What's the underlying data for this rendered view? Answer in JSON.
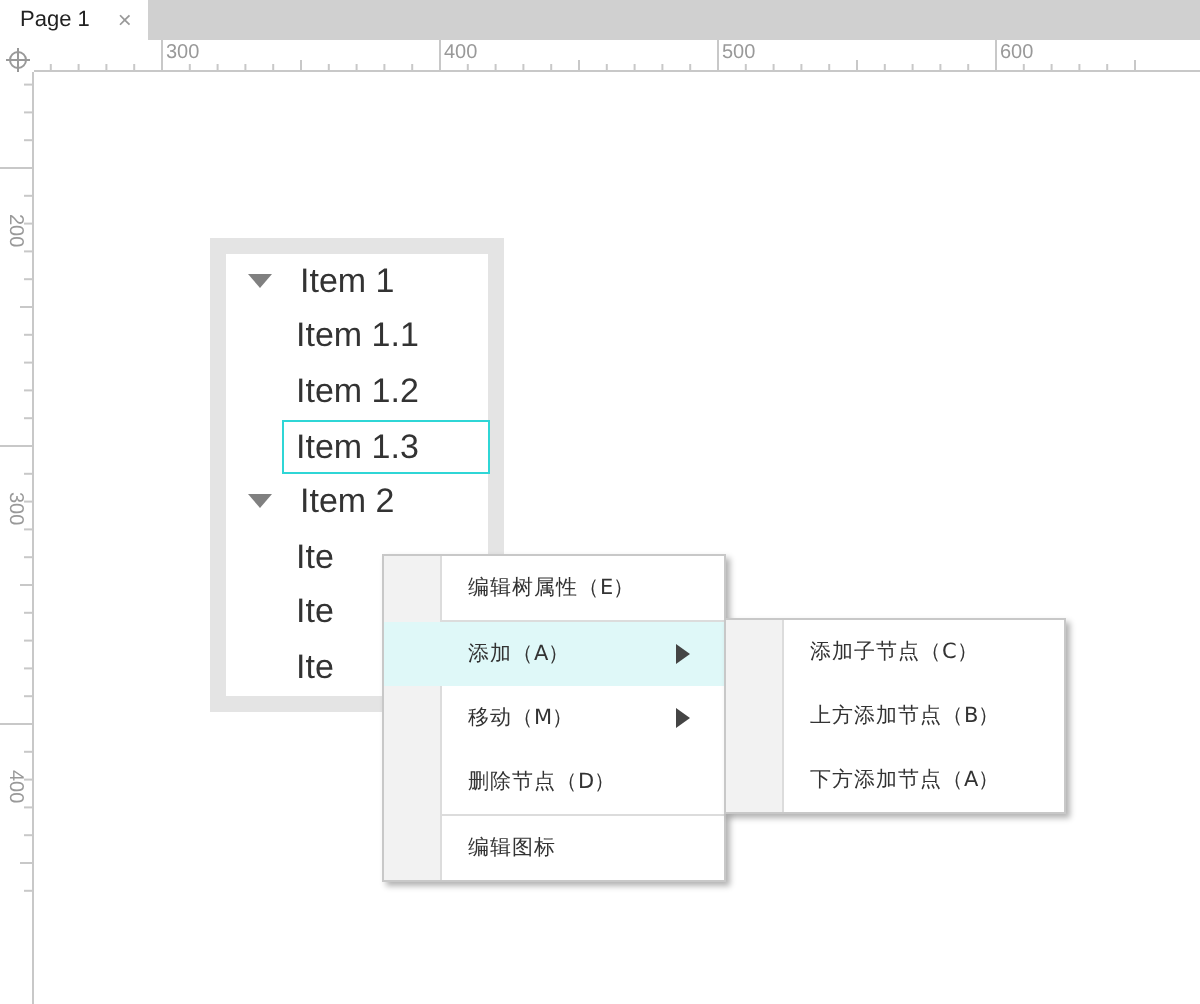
{
  "tabs": [
    {
      "label": "Page 1",
      "selected": true,
      "close": "×"
    }
  ],
  "ruler": {
    "top_labels": [
      "300",
      "400",
      "500",
      "600"
    ],
    "left_labels": [
      "200",
      "300",
      "400"
    ]
  },
  "tree": {
    "items": [
      {
        "label": "Item 1",
        "expanded": true,
        "selected": false,
        "children": [
          {
            "label": "Item 1.1",
            "selected": false
          },
          {
            "label": "Item 1.2",
            "selected": false
          },
          {
            "label": "Item 1.3",
            "selected": true
          }
        ]
      },
      {
        "label": "Item 2",
        "expanded": true,
        "selected": false,
        "children": [
          {
            "label": "Ite",
            "selected": false
          },
          {
            "label": "Ite",
            "selected": false
          },
          {
            "label": "Ite",
            "selected": false
          }
        ]
      }
    ]
  },
  "context_menu": {
    "items": [
      {
        "label": "编辑树属性（E）",
        "highlighted": false,
        "submenu": false,
        "separator_after": true
      },
      {
        "label": "添加（A）",
        "highlighted": true,
        "submenu": true,
        "separator_after": false
      },
      {
        "label": "移动（M）",
        "highlighted": false,
        "submenu": true,
        "separator_after": false
      },
      {
        "label": "删除节点（D）",
        "highlighted": false,
        "submenu": false,
        "separator_after": true
      },
      {
        "label": "编辑图标",
        "highlighted": false,
        "submenu": false,
        "separator_after": false
      }
    ]
  },
  "submenu": {
    "items": [
      {
        "label": "添加子节点（C）",
        "highlighted": false
      },
      {
        "label": "上方添加节点（B）",
        "highlighted": false
      },
      {
        "label": "下方添加节点（A）",
        "highlighted": false
      }
    ]
  }
}
